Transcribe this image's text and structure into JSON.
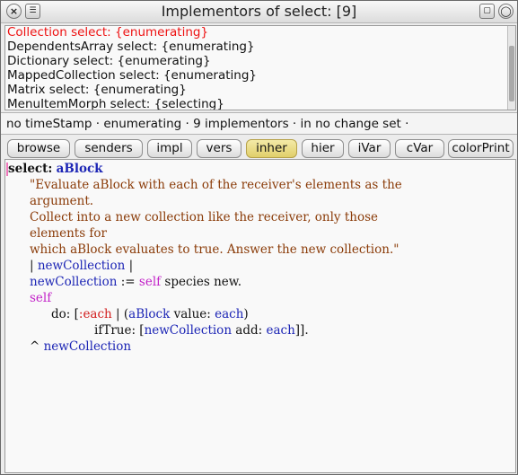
{
  "window": {
    "title": "Implementors of select: [9]",
    "close_icon": "×",
    "menu_icon": "☰",
    "collapse_icon": "▢",
    "expand_icon": "◯"
  },
  "implementors": [
    {
      "label": "Collection select: {enumerating}",
      "selected": true
    },
    {
      "label": "DependentsArray select: {enumerating}",
      "selected": false
    },
    {
      "label": "Dictionary select: {enumerating}",
      "selected": false
    },
    {
      "label": "MappedCollection select: {enumerating}",
      "selected": false
    },
    {
      "label": "Matrix select: {enumerating}",
      "selected": false
    },
    {
      "label": "MenuItemMorph select: {selecting}",
      "selected": false
    }
  ],
  "status": "no timeStamp · enumerating · 9 implementors · in no change set ·",
  "tabs": [
    {
      "label": "browse",
      "active": false
    },
    {
      "label": "senders",
      "active": false
    },
    {
      "label": "impl",
      "active": false
    },
    {
      "label": "vers",
      "active": false
    },
    {
      "label": "inher",
      "active": true
    },
    {
      "label": "hier",
      "active": false
    },
    {
      "label": "iVar",
      "active": false
    },
    {
      "label": "cVar",
      "active": false
    },
    {
      "label": "colorPrint",
      "active": false
    }
  ],
  "code": {
    "selector": "select:",
    "arg": "aBlock",
    "comment_lines": [
      "\"Evaluate aBlock with each of the receiver's elements as the",
      "argument.",
      "Collect into a new collection like the receiver, only those",
      "elements for",
      "which aBlock evaluates to true. Answer the new collection.\""
    ],
    "temps_open": "| ",
    "temp_var": "newCollection",
    "temps_close": " |",
    "assign_var": "newCollection",
    "assign_op": " := ",
    "self_kw": "self",
    "assign_rest": " species new.",
    "do_prefix": "do: [",
    "block_param": ":each",
    "do_mid": " | (",
    "do_recv": "aBlock",
    "do_value": " value: ",
    "do_each": "each",
    "do_close": ")",
    "iftrue_prefix": "ifTrue: [",
    "iftrue_recv": "newCollection",
    "iftrue_add": " add: ",
    "iftrue_each": "each",
    "iftrue_close": "]].",
    "return_op": "^ ",
    "return_var": "newCollection"
  }
}
